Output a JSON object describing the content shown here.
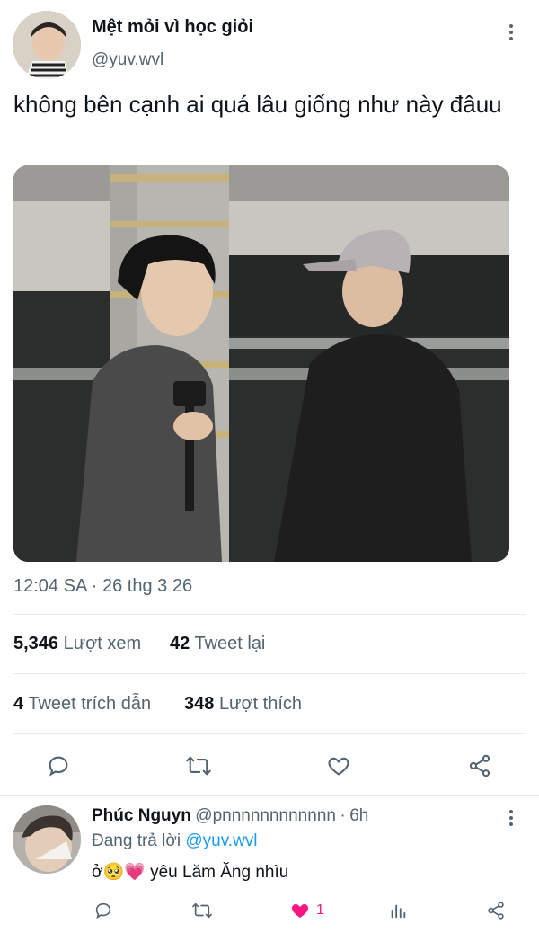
{
  "tweet": {
    "author_name": "Mệt mỏi vì học giỏi",
    "author_handle": "@yuv.wvl",
    "text": "không bên cạnh ai quá lâu giống như này đâuu",
    "time": "12:04 SA",
    "separator": "·",
    "date": "26 thg 3 26",
    "stats": {
      "views_count": "5,346",
      "views_label": "Lượt xem",
      "retweets_count": "42",
      "retweets_label": "Tweet lại",
      "quotes_count": "4",
      "quotes_label": "Tweet trích dẫn",
      "likes_count": "348",
      "likes_label": "Lượt thích"
    },
    "actions": [
      "reply-icon",
      "retweet-icon",
      "like-icon",
      "share-icon"
    ]
  },
  "reply": {
    "author_name": "Phúc Nguyn",
    "author_handle": "@pnnnnnnnnnnnn",
    "separator": "·",
    "age": "6h",
    "replying_prefix": "Đang trả lời",
    "replying_to": "@yuv.wvl",
    "text_prefix": "ở",
    "emoji_1": "🥺",
    "emoji_2": "💗",
    "text": "yêu Lăm Ăng nhìu",
    "like_count": "1",
    "actions": [
      "reply-icon",
      "retweet-icon",
      "like-icon",
      "views-icon",
      "share-icon"
    ]
  },
  "colors": {
    "text_primary": "#0f1419",
    "text_secondary": "#536471",
    "link": "#1d9bf0",
    "like_active": "#f91880",
    "divider": "#e6ecf0"
  }
}
